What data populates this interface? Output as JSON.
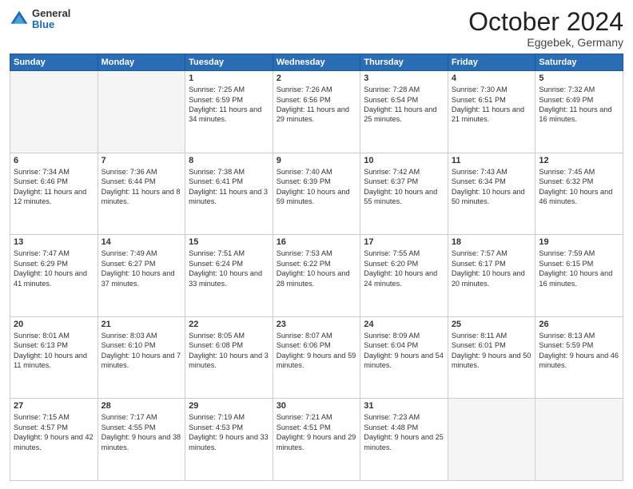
{
  "header": {
    "logo_general": "General",
    "logo_blue": "Blue",
    "month_title": "October 2024",
    "location": "Eggebek, Germany"
  },
  "weekdays": [
    "Sunday",
    "Monday",
    "Tuesday",
    "Wednesday",
    "Thursday",
    "Friday",
    "Saturday"
  ],
  "weeks": [
    [
      {
        "day": "",
        "empty": true
      },
      {
        "day": "",
        "empty": true
      },
      {
        "day": "1",
        "sunrise": "7:25 AM",
        "sunset": "6:59 PM",
        "daylight": "11 hours and 34 minutes."
      },
      {
        "day": "2",
        "sunrise": "7:26 AM",
        "sunset": "6:56 PM",
        "daylight": "11 hours and 29 minutes."
      },
      {
        "day": "3",
        "sunrise": "7:28 AM",
        "sunset": "6:54 PM",
        "daylight": "11 hours and 25 minutes."
      },
      {
        "day": "4",
        "sunrise": "7:30 AM",
        "sunset": "6:51 PM",
        "daylight": "11 hours and 21 minutes."
      },
      {
        "day": "5",
        "sunrise": "7:32 AM",
        "sunset": "6:49 PM",
        "daylight": "11 hours and 16 minutes."
      }
    ],
    [
      {
        "day": "6",
        "sunrise": "7:34 AM",
        "sunset": "6:46 PM",
        "daylight": "11 hours and 12 minutes."
      },
      {
        "day": "7",
        "sunrise": "7:36 AM",
        "sunset": "6:44 PM",
        "daylight": "11 hours and 8 minutes."
      },
      {
        "day": "8",
        "sunrise": "7:38 AM",
        "sunset": "6:41 PM",
        "daylight": "11 hours and 3 minutes."
      },
      {
        "day": "9",
        "sunrise": "7:40 AM",
        "sunset": "6:39 PM",
        "daylight": "10 hours and 59 minutes."
      },
      {
        "day": "10",
        "sunrise": "7:42 AM",
        "sunset": "6:37 PM",
        "daylight": "10 hours and 55 minutes."
      },
      {
        "day": "11",
        "sunrise": "7:43 AM",
        "sunset": "6:34 PM",
        "daylight": "10 hours and 50 minutes."
      },
      {
        "day": "12",
        "sunrise": "7:45 AM",
        "sunset": "6:32 PM",
        "daylight": "10 hours and 46 minutes."
      }
    ],
    [
      {
        "day": "13",
        "sunrise": "7:47 AM",
        "sunset": "6:29 PM",
        "daylight": "10 hours and 41 minutes."
      },
      {
        "day": "14",
        "sunrise": "7:49 AM",
        "sunset": "6:27 PM",
        "daylight": "10 hours and 37 minutes."
      },
      {
        "day": "15",
        "sunrise": "7:51 AM",
        "sunset": "6:24 PM",
        "daylight": "10 hours and 33 minutes."
      },
      {
        "day": "16",
        "sunrise": "7:53 AM",
        "sunset": "6:22 PM",
        "daylight": "10 hours and 28 minutes."
      },
      {
        "day": "17",
        "sunrise": "7:55 AM",
        "sunset": "6:20 PM",
        "daylight": "10 hours and 24 minutes."
      },
      {
        "day": "18",
        "sunrise": "7:57 AM",
        "sunset": "6:17 PM",
        "daylight": "10 hours and 20 minutes."
      },
      {
        "day": "19",
        "sunrise": "7:59 AM",
        "sunset": "6:15 PM",
        "daylight": "10 hours and 16 minutes."
      }
    ],
    [
      {
        "day": "20",
        "sunrise": "8:01 AM",
        "sunset": "6:13 PM",
        "daylight": "10 hours and 11 minutes."
      },
      {
        "day": "21",
        "sunrise": "8:03 AM",
        "sunset": "6:10 PM",
        "daylight": "10 hours and 7 minutes."
      },
      {
        "day": "22",
        "sunrise": "8:05 AM",
        "sunset": "6:08 PM",
        "daylight": "10 hours and 3 minutes."
      },
      {
        "day": "23",
        "sunrise": "8:07 AM",
        "sunset": "6:06 PM",
        "daylight": "9 hours and 59 minutes."
      },
      {
        "day": "24",
        "sunrise": "8:09 AM",
        "sunset": "6:04 PM",
        "daylight": "9 hours and 54 minutes."
      },
      {
        "day": "25",
        "sunrise": "8:11 AM",
        "sunset": "6:01 PM",
        "daylight": "9 hours and 50 minutes."
      },
      {
        "day": "26",
        "sunrise": "8:13 AM",
        "sunset": "5:59 PM",
        "daylight": "9 hours and 46 minutes."
      }
    ],
    [
      {
        "day": "27",
        "sunrise": "7:15 AM",
        "sunset": "4:57 PM",
        "daylight": "9 hours and 42 minutes."
      },
      {
        "day": "28",
        "sunrise": "7:17 AM",
        "sunset": "4:55 PM",
        "daylight": "9 hours and 38 minutes."
      },
      {
        "day": "29",
        "sunrise": "7:19 AM",
        "sunset": "4:53 PM",
        "daylight": "9 hours and 33 minutes."
      },
      {
        "day": "30",
        "sunrise": "7:21 AM",
        "sunset": "4:51 PM",
        "daylight": "9 hours and 29 minutes."
      },
      {
        "day": "31",
        "sunrise": "7:23 AM",
        "sunset": "4:48 PM",
        "daylight": "9 hours and 25 minutes."
      },
      {
        "day": "",
        "empty": true
      },
      {
        "day": "",
        "empty": true
      }
    ]
  ]
}
